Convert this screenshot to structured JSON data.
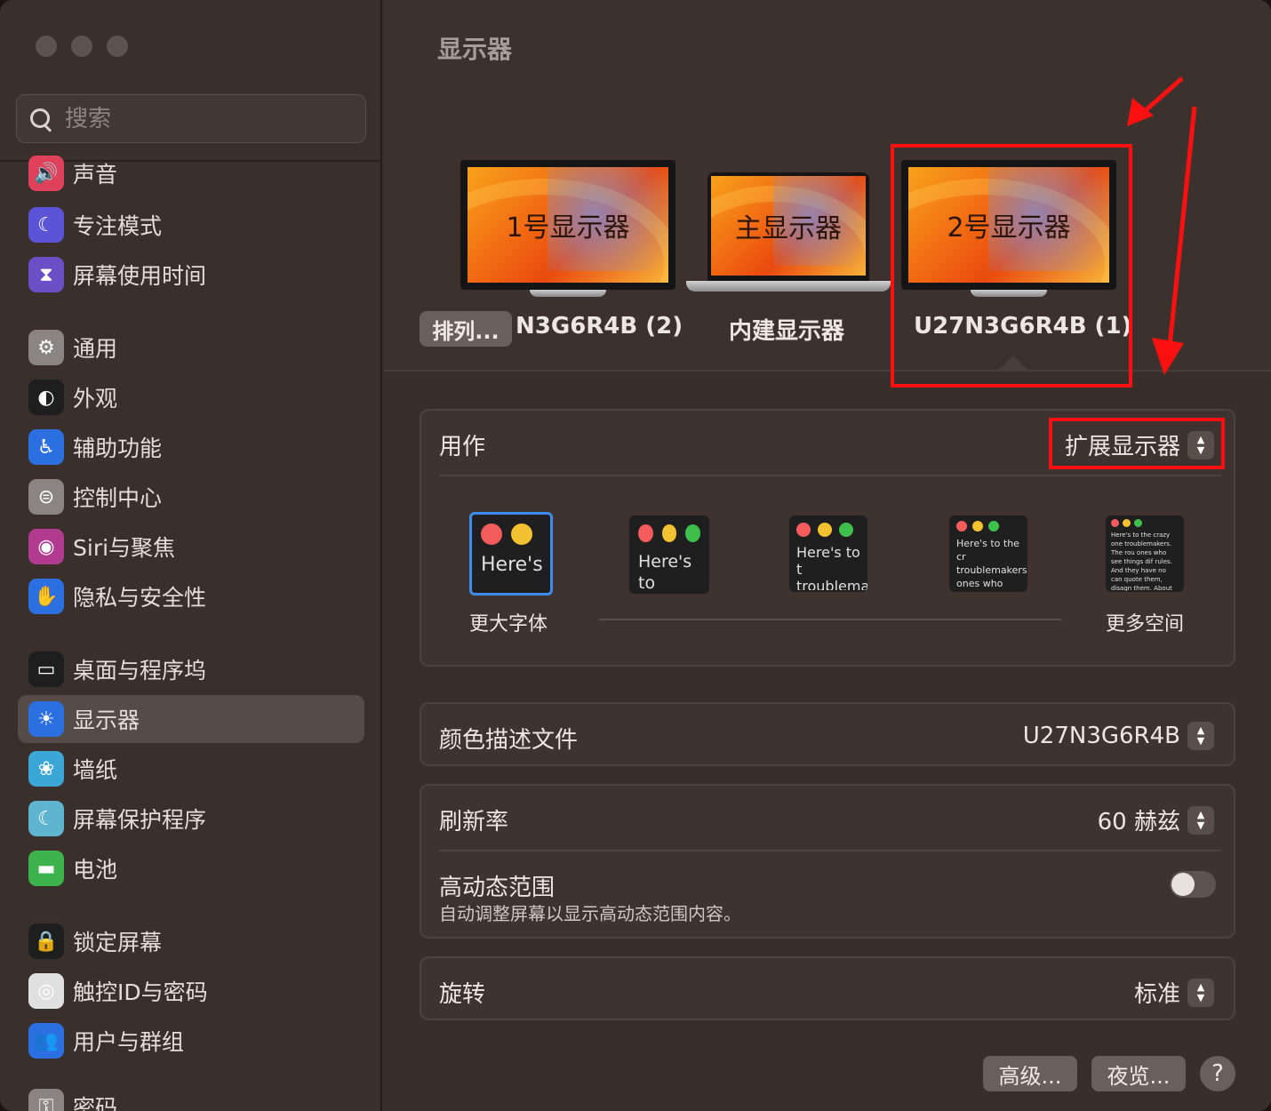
{
  "window": {
    "title": "显示器"
  },
  "search": {
    "placeholder": "搜索"
  },
  "sidebar": {
    "items": [
      {
        "label": "声音",
        "icon": "speaker-icon",
        "color": "#e0415a"
      },
      {
        "label": "专注模式",
        "icon": "moon-icon",
        "color": "#5b54d6"
      },
      {
        "label": "屏幕使用时间",
        "icon": "hourglass-icon",
        "color": "#6a4fc7"
      },
      {
        "label": "通用",
        "icon": "gear-icon",
        "color": "#8a8582"
      },
      {
        "label": "外观",
        "icon": "appearance-icon",
        "color": "#1e1e1e"
      },
      {
        "label": "辅助功能",
        "icon": "accessibility-icon",
        "color": "#2c6fe0"
      },
      {
        "label": "控制中心",
        "icon": "control-center-icon",
        "color": "#8a8582"
      },
      {
        "label": "Siri与聚焦",
        "icon": "siri-icon",
        "color": "#b23b8f"
      },
      {
        "label": "隐私与安全性",
        "icon": "hand-icon",
        "color": "#2c6fe0"
      },
      {
        "label": "桌面与程序坞",
        "icon": "dock-icon",
        "color": "#1e1e1e"
      },
      {
        "label": "显示器",
        "icon": "sun-icon",
        "color": "#2c6fe0"
      },
      {
        "label": "墙纸",
        "icon": "flower-icon",
        "color": "#3aa7d6"
      },
      {
        "label": "屏幕保护程序",
        "icon": "screensaver-icon",
        "color": "#5fb4cf"
      },
      {
        "label": "电池",
        "icon": "battery-icon",
        "color": "#3eb24d"
      },
      {
        "label": "锁定屏幕",
        "icon": "lock-icon",
        "color": "#1e1e1e"
      },
      {
        "label": "触控ID与密码",
        "icon": "fingerprint-icon",
        "color": "#e0e0e0"
      },
      {
        "label": "用户与群组",
        "icon": "users-icon",
        "color": "#2c6fe0"
      },
      {
        "label": "密码",
        "icon": "key-icon",
        "color": "#8a8582"
      }
    ],
    "selected": "显示器"
  },
  "displays": {
    "arrange_label": "排列...",
    "monitors": [
      {
        "screen_label": "1号显示器",
        "name": "N3G6R4B (2)"
      },
      {
        "screen_label": "主显示器",
        "name": "内建显示器"
      },
      {
        "screen_label": "2号显示器",
        "name": "U27N3G6R4B (1)"
      }
    ]
  },
  "use_as": {
    "label": "用作",
    "value": "扩展显示器"
  },
  "scaling": {
    "left_label": "更大字体",
    "right_label": "更多空间",
    "options": [
      {
        "text": "Here's",
        "selected": true
      },
      {
        "text": "Here's to troublem",
        "selected": false
      },
      {
        "text": "Here's to t troublema ones who",
        "selected": false
      },
      {
        "text": "Here's to the cr troublemakers. ones who see t rules. And they",
        "selected": false
      },
      {
        "text": "Here's to the crazy one troublemakers. The rou ones who see things dif rules. And they have no can quote them, disagn them. About the only th Because they change t",
        "selected": false
      }
    ]
  },
  "color_profile": {
    "label": "颜色描述文件",
    "value": "U27N3G6R4B"
  },
  "refresh_rate": {
    "label": "刷新率",
    "value": "60 赫兹"
  },
  "hdr": {
    "label": "高动态范围",
    "description": "自动调整屏幕以显示高动态范围内容。",
    "enabled": false
  },
  "rotation": {
    "label": "旋转",
    "value": "标准"
  },
  "buttons": {
    "advanced": "高级...",
    "night_shift": "夜览...",
    "help": "?"
  },
  "annotations": {
    "highlight_color": "#ff1010"
  }
}
